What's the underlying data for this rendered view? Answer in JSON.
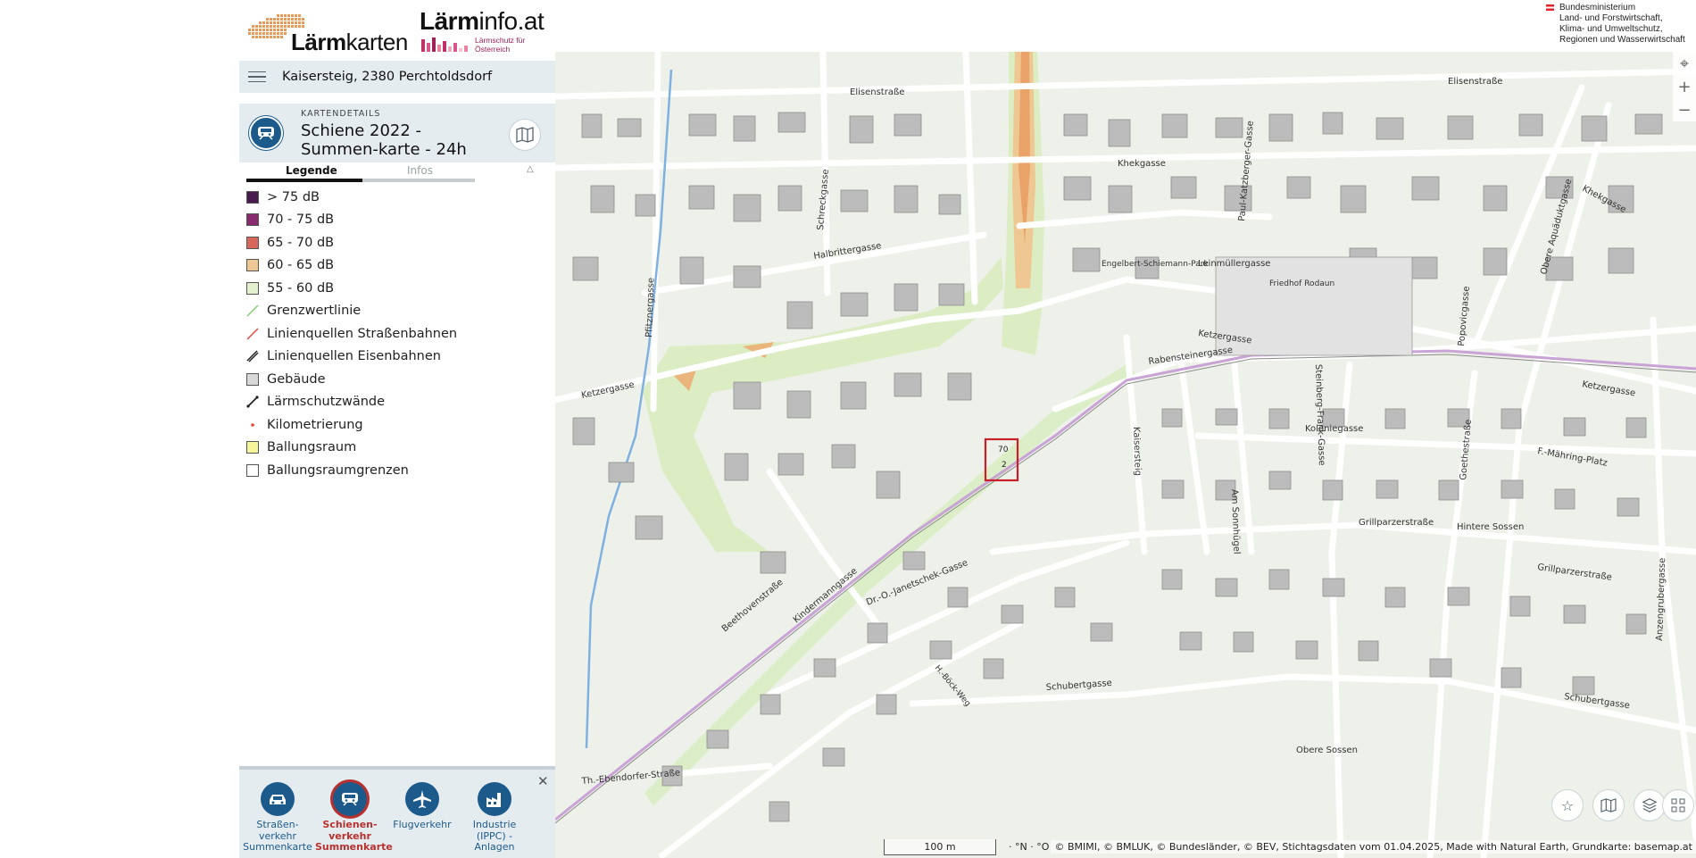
{
  "header": {
    "logo_left_prefix": "Lärm",
    "logo_left_suffix": "karten",
    "logo_right_prefix": "Lärm",
    "logo_right_suffix": "info.at",
    "logo_right_sub1": "Lärmschutz für",
    "logo_right_sub2": "Österreich",
    "ministry": [
      "Bundesministerium",
      "Land- und Forstwirtschaft,",
      "Klima- und Umweltschutz,",
      "Regionen und Wasserwirtschaft"
    ]
  },
  "search": {
    "value": "Kaisersteig, 2380 Perchtoldsdorf"
  },
  "details": {
    "kicker": "KARTENDETAILS",
    "title": "Schiene 2022 - Summen-karte - 24h"
  },
  "tabs": [
    {
      "label": "Legende",
      "active": true
    },
    {
      "label": "Infos",
      "active": false
    }
  ],
  "legend": [
    {
      "label": "> 75 dB",
      "kind": "box",
      "color": "#4a1b4e"
    },
    {
      "label": "70 - 75 dB",
      "kind": "box",
      "color": "#8a2a6e"
    },
    {
      "label": "65 - 70 dB",
      "kind": "box",
      "color": "#d9675a"
    },
    {
      "label": "60 - 65 dB",
      "kind": "box",
      "color": "#eec792"
    },
    {
      "label": "55 - 60 dB",
      "kind": "box",
      "color": "#e3f1cf"
    },
    {
      "label": "Grenzwertlinie",
      "kind": "line",
      "color": "#7fd36b"
    },
    {
      "label": "Linienquellen Straßenbahnen",
      "kind": "line",
      "color": "#e2463f"
    },
    {
      "label": "Linienquellen Eisenbahnen",
      "kind": "double-line",
      "color": "#222222"
    },
    {
      "label": "Gebäude",
      "kind": "box",
      "color": "#d8d8d8"
    },
    {
      "label": "Lärmschutzwände",
      "kind": "wall",
      "color": "#222222"
    },
    {
      "label": "Kilometrierung",
      "kind": "dot",
      "color": "#e2463f"
    },
    {
      "label": "Ballungsraum",
      "kind": "box",
      "color": "#f7f59a"
    },
    {
      "label": "Ballungsraumgrenzen",
      "kind": "box",
      "color": "#ffffff"
    }
  ],
  "modes": [
    {
      "label": "Straßen-verkehr Summenkarte",
      "icon": "car-icon",
      "active": false
    },
    {
      "label": "Schienen-verkehr Summenkarte",
      "icon": "train-icon",
      "active": true
    },
    {
      "label": "Flugverkehr",
      "icon": "plane-icon",
      "active": false
    },
    {
      "label": "Industrie (IPPC) - Anlagen",
      "icon": "factory-icon",
      "active": false
    }
  ],
  "map": {
    "streets": [
      "Elisenstraße",
      "Khekgasse",
      "Halbrittergasse",
      "Leinmüllergasse",
      "Ketzergasse",
      "Rabensteinergasse",
      "Koloniegasse",
      "F.-Mähring-Platz",
      "Grillparzerstraße",
      "Hintere Sossen",
      "Beethovenstraße",
      "Kindermanngasse",
      "Dr.-O.-Janetschek-Gasse",
      "Kaisersteig",
      "Schubertgasse",
      "Th.-Ebendorfer-Straße",
      "Goethestraße",
      "Anzengrubergasse",
      "Obere Sossen",
      "Pfitznergasse",
      "Schreckgasse",
      "Paul-Katzberger-Gasse",
      "Steinberg-Frank-Gasse",
      "Am Sonnhügel",
      "Popovicgasse",
      "Obere Aquäduktgasse",
      "Engelbert-Schiemann-Park",
      "Friedhof Rodaun",
      "H.-Böck-Weg"
    ],
    "marker_numbers": [
      "70",
      "2"
    ],
    "scale_label": "100 m",
    "coords": "· °N · °O",
    "attribution": "© BMIMI, © BMLUK, © Bundesländer, © BEV, Stichtagsdaten vom 01.04.2025, Made with Natural Earth, Grundkarte: basemap.at"
  },
  "colors": {
    "accent": "#1c5a8c",
    "active_mode": "#b8312f",
    "panel_bg": "#e5ecf0"
  }
}
